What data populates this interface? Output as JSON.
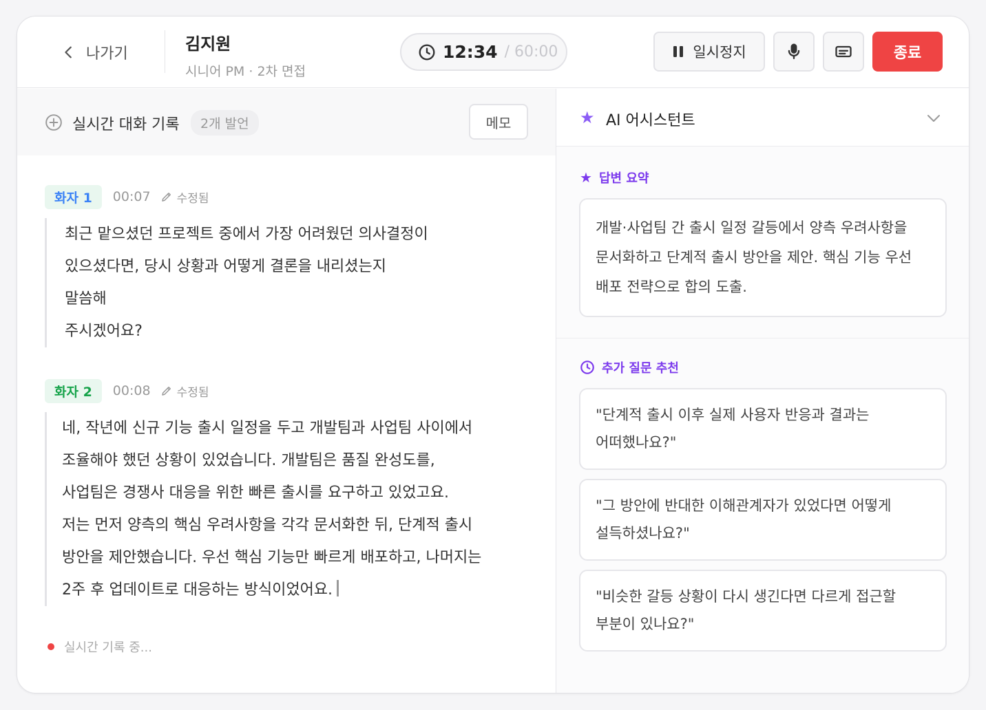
{
  "header": {
    "back_label": "나가기",
    "candidate_name": "김지원",
    "candidate_sub": "시니어 PM · 2차 면접",
    "timer_current": "12:34",
    "timer_total": "/ 60:00",
    "pause_label": "일시정지",
    "end_label": "종료"
  },
  "transcript": {
    "title": "실시간 대화 기록",
    "count": "2개 발언",
    "memo_label": "메모",
    "utterances": [
      {
        "speaker": "화자 1",
        "time": "00:07",
        "edited": "수정됨",
        "lines": [
          "최근 맡으셨던 프로젝트 중에서 가장 어려웠던 의사결정이",
          "있으셨다면, 당시 상황과 어떻게 결론을 내리셨는지",
          "말씀해",
          "주시겠어요?"
        ]
      },
      {
        "speaker": "화자 2",
        "time": "00:08",
        "edited": "수정됨",
        "lines": [
          "네, 작년에 신규 기능 출시 일정을 두고 개발팀과 사업팀 사이에서",
          "조율해야 했던 상황이 있었습니다. 개발팀은 품질 완성도를,",
          "사업팀은 경쟁사 대응을 위한 빠른 출시를 요구하고 있었고요.",
          "저는 먼저 양측의 핵심 우려사항을 각각 문서화한 뒤, 단계적 출시",
          "방안을 제안했습니다. 우선 핵심 기능만 빠르게 배포하고, 나머지는",
          "2주 후 업데이트로 대응하는 방식이었어요."
        ]
      }
    ],
    "live_status": "실시간 기록 중..."
  },
  "assistant": {
    "title": "AI 어시스턴트",
    "summary_title": "답변 요약",
    "summary_lines": [
      "개발·사업팀 간 출시 일정 갈등에서 양측 우려사항을",
      "문서화하고 단계적 출시 방안을 제안. 핵심 기능 우선",
      "배포 전략으로 합의 도출."
    ],
    "suggest_title": "추가 질문 추천",
    "suggestions": [
      {
        "line1": "\"단계적 출시 이후 실제 사용자 반응과 결과는",
        "line2": "어떠했나요?\""
      },
      {
        "line1": "\"그 방안에 반대한 이해관계자가 있었다면 어떻게",
        "line2": "설득하셨나요?\""
      },
      {
        "line1": "\"비슷한 갈등 상황이 다시 생긴다면 다르게 접근할",
        "line2": "부분이 있나요?\""
      }
    ]
  },
  "colors": {
    "accent": "#7c3aed",
    "danger": "#ef4444",
    "speaker1": "#3b82f6",
    "speaker2": "#16a34a"
  },
  "icons": [
    "chevron-left-icon",
    "clock-icon",
    "pause-icon",
    "mic-icon",
    "caption-icon",
    "plus-circle-icon",
    "pencil-icon",
    "star-icon",
    "chevron-down-icon"
  ]
}
